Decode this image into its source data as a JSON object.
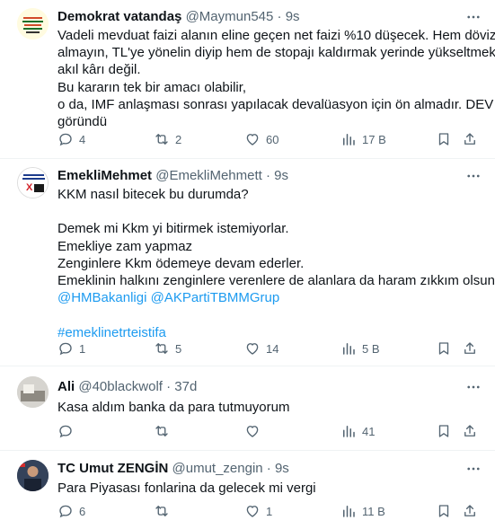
{
  "tweets": [
    {
      "name": "Demokrat vatandaş",
      "handle": "@Maymun545",
      "dot": "·",
      "time": "9s",
      "lines": [
        "Vadeli mevduat  faizi alanın eline geçen net faizi %10 düşecek. Hem döviz",
        "almayın, TL'ye yönelin diyip hem de stopajı kaldırmak yerinde yükseltmek",
        "akıl kârı değil.",
        "Bu kararın tek bir amacı olabilir,",
        "o da, IMF anlaşması sonrası yapılacak devalüasyon için ön almadır. DEV",
        "göründü"
      ],
      "replies": "4",
      "retweets": "2",
      "likes": "60",
      "views": "17 B"
    },
    {
      "name": "EmekliMehmet",
      "handle": "@EmekliMehmett",
      "dot": "·",
      "time": "9s",
      "lines": [
        "KKM nasıl bitecek bu durumda?",
        "",
        "Demek mi Kkm yi bitirmek istemiyorlar.",
        "Emekliye zam yapmaz",
        "Zenginlere Kkm ödemeye devam ederler.",
        "Emeklinin halkını zenginlere verenlere de alanlara da  haram zıkkım olsun."
      ],
      "mentions": [
        "@HMBakanligi",
        "@AKPartiTBMMGrup"
      ],
      "hashtag": "#emeklinetrteistifa",
      "replies": "1",
      "retweets": "5",
      "likes": "14",
      "views": "5 B"
    },
    {
      "name": "Ali",
      "handle": "@40blackwolf",
      "dot": "·",
      "time": "37d",
      "lines": [
        "Kasa aldım banka da para tutmuyorum"
      ],
      "replies": "",
      "retweets": "",
      "likes": "",
      "views": "41"
    },
    {
      "name": "TC Umut ZENGİN",
      "handle": "@umut_zengin",
      "dot": "·",
      "time": "9s",
      "lines": [
        "Para Piyasası fonlarina da gelecek mi vergi"
      ],
      "replies": "6",
      "retweets": "",
      "likes": "1",
      "views": "11 B"
    }
  ],
  "icons": {
    "more": "more-dots-icon",
    "reply": "reply-bubble-icon",
    "retweet": "retweet-icon",
    "like": "heart-icon",
    "views": "views-bars-icon",
    "bookmark": "bookmark-icon",
    "share": "share-upload-icon"
  },
  "colors": {
    "text": "#0f1419",
    "secondary": "#536471",
    "link": "#1d9bf0",
    "divider": "#eff3f4"
  }
}
